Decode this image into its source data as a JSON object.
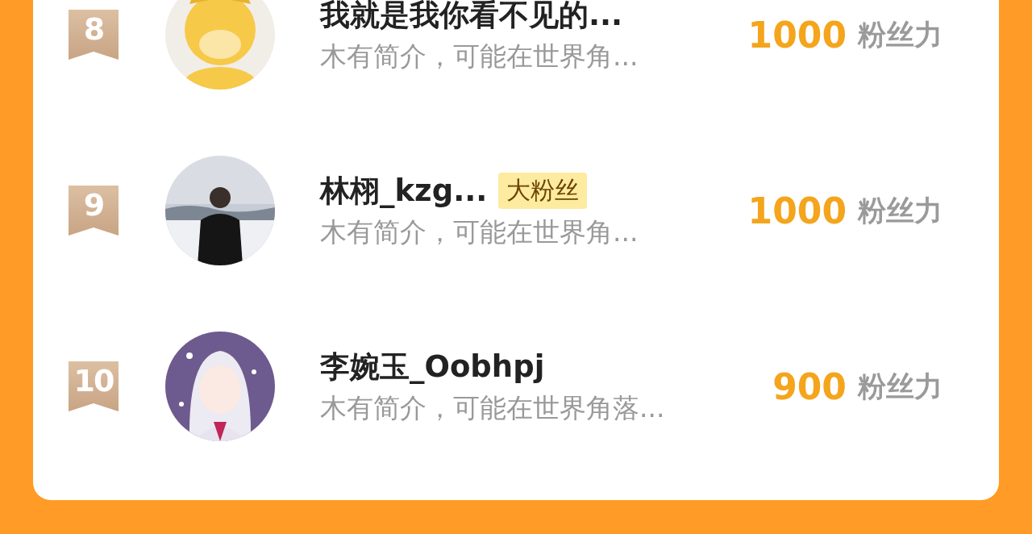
{
  "fans": [
    {
      "rank": "8",
      "name": "我就是我你看不见的...",
      "intro": "木有简介，可能在世界角...",
      "score": "1000",
      "unit": "粉丝力"
    },
    {
      "rank": "9",
      "name": "林栩_kzg...",
      "tag": "大粉丝",
      "intro": "木有简介，可能在世界角...",
      "score": "1000",
      "unit": "粉丝力"
    },
    {
      "rank": "10",
      "name": "李婉玉_Oobhpj",
      "intro": "木有简介，可能在世界角落...",
      "score": "900",
      "unit": "粉丝力"
    }
  ]
}
